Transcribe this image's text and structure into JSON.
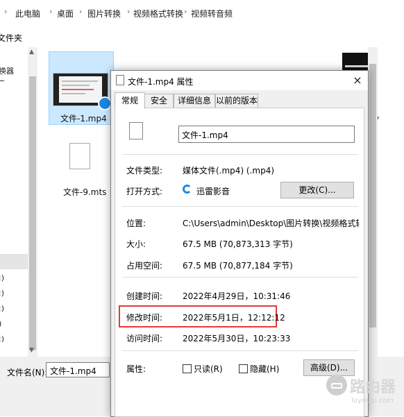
{
  "breadcrumb": [
    "此电脑",
    "桌面",
    "图片转换",
    "视频格式转换",
    "视频转音频"
  ],
  "ribbon_text": "文件夹",
  "nav": {
    "items": [
      "换器",
      ":)",
      ":)",
      ":)",
      ")",
      ":)"
    ]
  },
  "files": [
    {
      "name": "文件-1.mp4"
    },
    {
      "name": "文件-9.mts"
    },
    {
      "name": "kv"
    }
  ],
  "filename_field": {
    "label": "文件名(N):",
    "value": "文件-1.mp4"
  },
  "dialog": {
    "title": "文件-1.mp4 属性",
    "close": "×",
    "tabs": [
      "常规",
      "安全",
      "详细信息",
      "以前的版本"
    ],
    "filename": "文件-1.mp4",
    "rows": {
      "type_label": "文件类型:",
      "type_value": "媒体文件(.mp4) (.mp4)",
      "open_label": "打开方式:",
      "open_value": "迅雷影音",
      "change_btn": "更改(C)...",
      "location_label": "位置:",
      "location_value": "C:\\Users\\admin\\Desktop\\图片转换\\视频格式转换\\视",
      "size_label": "大小:",
      "size_value": "67.5 MB (70,873,313 字节)",
      "disk_label": "占用空间:",
      "disk_value": "67.5 MB (70,877,184 字节)",
      "created_label": "创建时间:",
      "created_value": "2022年4月29日，10:31:46",
      "modified_label": "修改时间:",
      "modified_value": "2022年5月1日，12:12:12",
      "accessed_label": "访问时间:",
      "accessed_value": "2022年5月30日，10:23:33",
      "attr_label": "属性:",
      "readonly": "只读(R)",
      "hidden": "隐藏(H)",
      "advanced_btn": "高级(D)..."
    }
  },
  "watermark": {
    "title": "路由器",
    "url": "luyouqi.com"
  },
  "colors": {
    "highlight": "#e53935",
    "selection": "#cce8ff",
    "thunder_blue": "#1e88e5"
  }
}
